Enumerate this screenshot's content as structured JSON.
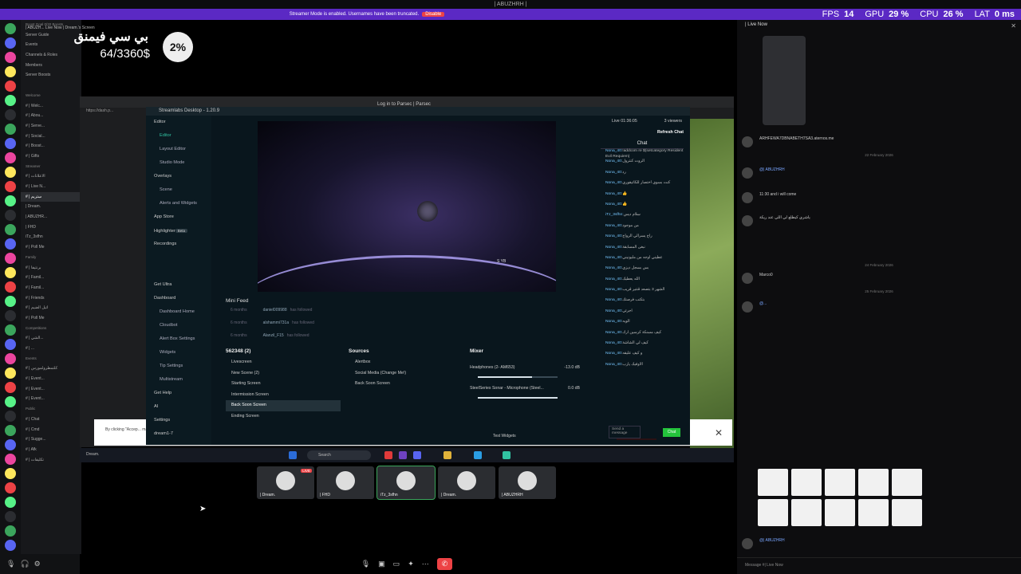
{
  "window_title": "| ABUZHRH |",
  "notice": {
    "message": "Streamer Mode is enabled. Usernames have been truncated.",
    "action": "Disable"
  },
  "perf": {
    "fps_label": "FPS",
    "fps": "14",
    "gpu_label": "GPU",
    "gpu": "29 %",
    "cpu_label": "CPU",
    "cpu": "26 %",
    "lat_label": "LAT",
    "lat": "0 ms"
  },
  "stream": {
    "header": "| ABUZH...  Live Now   | Dream.'s Screen",
    "goal_title": "بي سي فيمنق",
    "goal_amount": "64/3360$",
    "goal_percent": "2%",
    "goal_percent_value": 0.02
  },
  "channels": [
    {
      "label": "Boost Goal   0/32 Boosts",
      "type": "cat"
    },
    {
      "label": "Server Guide",
      "type": "item"
    },
    {
      "label": "Events",
      "type": "item"
    },
    {
      "label": "Channels & Roles",
      "type": "item"
    },
    {
      "label": "Members",
      "type": "item"
    },
    {
      "label": "Server Boosts",
      "type": "item"
    },
    {
      "label": "",
      "type": "gap"
    },
    {
      "label": "Welcome",
      "type": "cat"
    },
    {
      "label": "# | Welc...",
      "type": "item"
    },
    {
      "label": "# | Abou...",
      "type": "item"
    },
    {
      "label": "# | Serve...",
      "type": "item"
    },
    {
      "label": "# | Social...",
      "type": "item"
    },
    {
      "label": "# | Boost...",
      "type": "item"
    },
    {
      "label": "# | Gifts",
      "type": "item"
    },
    {
      "label": "Streamer",
      "type": "cat"
    },
    {
      "label": "# | الاعلانات",
      "type": "item"
    },
    {
      "label": "# | Live N...",
      "type": "item"
    },
    {
      "label": "# | ستريم",
      "type": "active"
    },
    {
      "label": "| Dream.",
      "type": "item"
    },
    {
      "label": "| ABUZHR...",
      "type": "item"
    },
    {
      "label": "| FHD",
      "type": "item"
    },
    {
      "label": "iTz_3sfhn",
      "type": "item"
    },
    {
      "label": "# | Poll Me",
      "type": "item"
    },
    {
      "label": "Family",
      "type": "cat"
    },
    {
      "label": "# | برنتيفا",
      "type": "item"
    },
    {
      "label": "# | Famil...",
      "type": "item"
    },
    {
      "label": "# | Famil...",
      "type": "item"
    },
    {
      "label": "# | Friends",
      "type": "item"
    },
    {
      "label": "# | اتيل الضيم",
      "type": "item"
    },
    {
      "label": "# | Poll Me",
      "type": "item"
    },
    {
      "label": "Competitions",
      "type": "cat"
    },
    {
      "label": "# | الشي...",
      "type": "item"
    },
    {
      "label": "# | ...",
      "type": "item"
    },
    {
      "label": "Events",
      "type": "cat"
    },
    {
      "label": "# | كلتمطرولمورس",
      "type": "item"
    },
    {
      "label": "# | Event...",
      "type": "item"
    },
    {
      "label": "# | Event...",
      "type": "item"
    },
    {
      "label": "# | Event...",
      "type": "item"
    },
    {
      "label": "Public",
      "type": "cat"
    },
    {
      "label": "# | Chat",
      "type": "item"
    },
    {
      "label": "# | Cmd",
      "type": "item"
    },
    {
      "label": "# | Sugge...",
      "type": "item"
    },
    {
      "label": "# | Afk",
      "type": "item"
    },
    {
      "label": "# | تكليفات",
      "type": "item"
    }
  ],
  "voice_connected": "Voice Connect",
  "browser": {
    "tab": "https://dash.p...",
    "streamlabs_title": "Streamlabs Desktop - 1.20.9",
    "parsec_title": "Log in to Parsec | Parsec",
    "cookie_text": "By clicking \"Accep... marketing efforts."
  },
  "nav": [
    {
      "label": "Editor",
      "kind": "head"
    },
    {
      "label": "Editor",
      "kind": "active"
    },
    {
      "label": "Layout Editor",
      "kind": "sub"
    },
    {
      "label": "Studio Mode",
      "kind": "sub"
    },
    {
      "label": "Overlays",
      "kind": "head"
    },
    {
      "label": "Scene",
      "kind": "sub"
    },
    {
      "label": "Alerts and Widgets",
      "kind": "sub"
    },
    {
      "label": "App Store",
      "kind": "head"
    },
    {
      "label": "Highlighter",
      "kind": "head",
      "badge": "Beta"
    },
    {
      "label": "Recordings",
      "kind": "head"
    },
    {
      "label": "",
      "kind": "gap"
    },
    {
      "label": "",
      "kind": "gap"
    },
    {
      "label": "Get Ultra",
      "kind": "head"
    },
    {
      "label": "Dashboard",
      "kind": "head"
    },
    {
      "label": "Dashboard Home",
      "kind": "sub"
    },
    {
      "label": "Cloudbot",
      "kind": "sub"
    },
    {
      "label": "Alert Box Settings",
      "kind": "sub"
    },
    {
      "label": "Widgets",
      "kind": "sub"
    },
    {
      "label": "Tip Settings",
      "kind": "sub"
    },
    {
      "label": "Multistream",
      "kind": "sub"
    },
    {
      "label": "Get Help",
      "kind": "head"
    },
    {
      "label": "AI",
      "kind": "head"
    },
    {
      "label": "Settings",
      "kind": "head"
    },
    {
      "label": "dream1-7",
      "kind": "head"
    }
  ],
  "preview_tag": "S YB",
  "mini_feed": {
    "title": "Mini Feed",
    "rows": [
      {
        "time": "6 months",
        "name": "daniel009988",
        "action": "has followed"
      },
      {
        "time": "6 months",
        "name": "alshammi731a",
        "action": "has followed"
      },
      {
        "time": "6 months",
        "name": "Alanzil_F15",
        "action": "has followed"
      }
    ]
  },
  "scenes": {
    "title": "562348 (2)",
    "items": [
      "Livescreen",
      "New Scene (2)",
      "Starting Screen",
      "Intermission Screen",
      "Back Soon Screen",
      "Ending Screen"
    ],
    "selected": 4
  },
  "sources": {
    "title": "Sources",
    "items": [
      "Alertbox",
      "Social Media (Change Me!)",
      "Back Soon Screen"
    ]
  },
  "mixer": {
    "title": "Mixer",
    "channels": [
      {
        "name": "Headphones (2- AM653)",
        "level": "-13.0 dB",
        "fill": 0.68
      },
      {
        "name": "SteelSeries Sonar - Microphone (Steel...",
        "level": "0.0 dB",
        "fill": 1.0
      }
    ]
  },
  "footer": {
    "test_widgets": "Test Widgets",
    "end_stream": "End Stream"
  },
  "sl_chat": {
    "live_time": "Live 01:36:05",
    "viewers": "3 viewers",
    "refresh": "Refresh Chat",
    "tab": "Chat",
    "messages": [
      {
        "user": "Nona_40:",
        "text": "!addcom re $(setcategory Resident Evil Requiem)"
      },
      {
        "user": "Nona_40:",
        "text": "الروت كنترول"
      },
      {
        "user": "Nona_40:",
        "text": "رد"
      },
      {
        "user": "Nona_40:",
        "text": "كنت بسوي اختصار للكاتيقوري"
      },
      {
        "user": "Nona_40:",
        "text": "👍"
      },
      {
        "user": "Nona_40:",
        "text": "👍"
      },
      {
        "user": "iTz_3sfhn:",
        "text": "سلام ديس"
      },
      {
        "user": "Nona_40:",
        "text": "من موجود"
      },
      {
        "user": "Nona_40:",
        "text": "راح يسرالي الرواح"
      },
      {
        "user": "Nona_40:",
        "text": "نبغى المسابقة"
      },
      {
        "user": "Nona_40:",
        "text": "عطيني اوجه من مليونيني"
      },
      {
        "user": "Nona_40:",
        "text": "بس بسجل ديزي"
      },
      {
        "user": "Nona_40:",
        "text": "الله يعطيك"
      },
      {
        "user": "Nona_40:",
        "text": "الشهر 3 بتصعد قنتير قريب"
      },
      {
        "user": "Nona_40:",
        "text": "بتكتب فرصتك"
      },
      {
        "user": "Nona_40:",
        "text": "اجرئي"
      },
      {
        "user": "Nona_40:",
        "text": "الويه"
      },
      {
        "user": "Nona_40:",
        "text": "كيف مسنكة كرسين ارك"
      },
      {
        "user": "Nona_40:",
        "text": "كيف لي الشاشة"
      },
      {
        "user": "Nona_40:",
        "text": "و كيف عليقه"
      },
      {
        "user": "Nona_40:",
        "text": "الاوفيك يارب"
      }
    ],
    "input_placeholder": "Send a message",
    "send": "Chat"
  },
  "taskbar": {
    "left": "Dream.",
    "search": "Search"
  },
  "tiles": [
    {
      "name": "| Dream.",
      "live": "LIVE"
    },
    {
      "name": "| FHD",
      "live": ""
    },
    {
      "name": "iTz_3sfhn",
      "live": ""
    },
    {
      "name": "| Dream.",
      "live": ""
    },
    {
      "name": "| ABUZHRH",
      "live": ""
    }
  ],
  "right": {
    "header": "| Live Now",
    "messages": [
      {
        "text": "ARHFEWA7DBNABETH7SA3.aternos.me",
        "link": false
      },
      {
        "text": "@| ABUZHRH",
        "link": true
      },
      {
        "text": "11:30 and i will come",
        "link": false
      },
      {
        "text": "ياشري كيطلع لي اللي عند ريكة",
        "link": false
      },
      {
        "text": "Marco0",
        "link": false
      },
      {
        "text": "@...",
        "link": true
      },
      {
        "text": "@| ABUZHRH",
        "link": true
      }
    ],
    "dates": [
      "22 February 2026",
      "24 February 2026",
      "25 February 2026"
    ],
    "input_placeholder": "Message #| Live Now"
  },
  "icons": [
    "gear-icon",
    "mic-icon",
    "headphones-icon",
    "screen-icon",
    "close-icon",
    "chevron-icon",
    "search-icon",
    "leave-icon"
  ]
}
